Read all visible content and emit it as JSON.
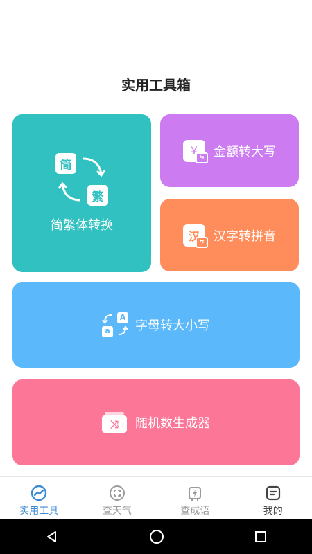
{
  "page_title": "实用工具箱",
  "cards": {
    "simp_trad": {
      "label": "简繁体转换",
      "glyph_top": "简",
      "glyph_bottom": "繁",
      "color": "#31c1c0"
    },
    "amount": {
      "label": "金额转大写",
      "glyph": "¥",
      "color": "#cc7bf0"
    },
    "pinyin": {
      "label": "汉字转拼音",
      "glyph": "汉",
      "color": "#ff8d5c"
    },
    "letter_case": {
      "label": "字母转大小写",
      "glyph_a_upper": "A",
      "glyph_a_lower": "a",
      "color": "#5ab8fb"
    },
    "random": {
      "label": "随机数生成器",
      "color": "#fc7698"
    }
  },
  "tabs": [
    {
      "label": "实用工具",
      "icon": "tools-icon",
      "active": true
    },
    {
      "label": "查天气",
      "icon": "weather-icon",
      "active": false
    },
    {
      "label": "查成语",
      "icon": "idiom-icon",
      "active": false
    },
    {
      "label": "我的",
      "icon": "profile-icon",
      "active": false
    }
  ],
  "colors": {
    "active_tab": "#3c8ad6",
    "inactive_tab": "#9a9a9a"
  }
}
